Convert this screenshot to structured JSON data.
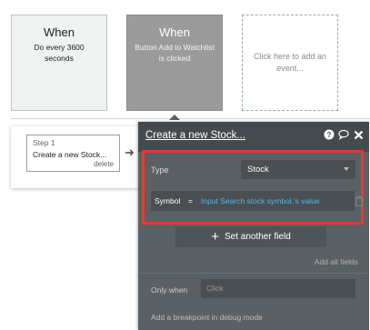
{
  "events": [
    {
      "title": "When",
      "description": "Do every 3600 seconds"
    },
    {
      "title": "When",
      "description": "Button Add to Watchlist is clicked"
    },
    {
      "placeholder": "Click here to add an event..."
    }
  ],
  "step": {
    "label": "Step 1",
    "name": "Create a new Stock...",
    "delete_label": "delete"
  },
  "editor": {
    "title": "Create a new Stock...",
    "icons": [
      "help-icon",
      "comment-icon",
      "close-icon"
    ],
    "type_label": "Type",
    "type_value": "Stock",
    "field_key": "Symbol",
    "field_eq": "=",
    "field_value": "Input Search stock symbol.'s value",
    "set_field_label": "Set another field",
    "add_all_label": "Add all fields",
    "only_when_label": "Only when",
    "only_when_placeholder": "Click",
    "debug_label": "Add a breakpoint in debug mode"
  },
  "colors": {
    "highlight": "#e53a2f",
    "dynamic_value": "#57b3e6",
    "panel_bg": "#5b6064"
  }
}
